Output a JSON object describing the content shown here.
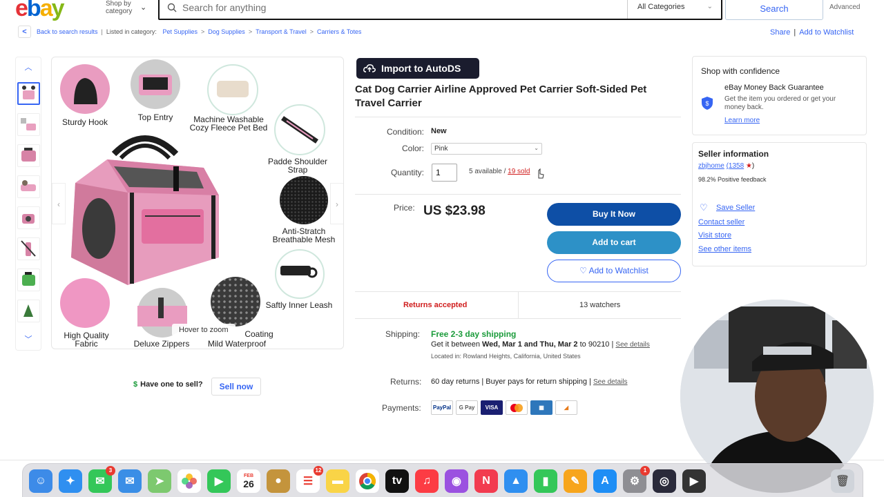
{
  "header": {
    "logo": [
      "e",
      "b",
      "a",
      "y"
    ],
    "shop_by_line1": "Shop by",
    "shop_by_line2": "category",
    "search_placeholder": "Search for anything",
    "category": "All Categories",
    "search_label": "Search",
    "advanced_label": "Advanced"
  },
  "breadcrumb": {
    "back": "Back to search results",
    "listed_in": "Listed in category:",
    "items": [
      "Pet Supplies",
      "Dog Supplies",
      "Transport & Travel",
      "Carriers & Totes"
    ],
    "share": "Share",
    "add_watchlist": "Add to Watchlist"
  },
  "gallery": {
    "features": [
      "Sturdy Hook",
      "Top Entry",
      "Machine Washable Cozy Fleece Pet Bed",
      "Padde Shoulder Strap",
      "Anti-Stratch Breathable Mesh",
      "Saftly Inner Leash",
      "High Quality Fabric",
      "Deluxe Zippers",
      "Mild Waterproof"
    ],
    "coating_fragment": "Coating",
    "hover_zoom": "Hover to zoom"
  },
  "sell": {
    "question": "Have one to sell?",
    "button": "Sell now"
  },
  "listing": {
    "autods_button": "Import to AutoDS",
    "title": "Cat Dog Carrier Airline Approved Pet Carrier Soft-Sided Pet Travel Carrier",
    "condition_label": "Condition:",
    "condition_value": "New",
    "color_label": "Color:",
    "color_value": "Pink",
    "quantity_label": "Quantity:",
    "quantity_value": "1",
    "available": "5 available /",
    "sold": "19 sold",
    "price_label": "Price:",
    "price": "US $23.98",
    "buy_now": "Buy It Now",
    "add_to_cart": "Add to cart",
    "add_to_watchlist": "♡ Add to Watchlist",
    "returns_accepted": "Returns accepted",
    "watchers": "13 watchers",
    "shipping_label": "Shipping:",
    "shipping_free": "Free 2-3 day shipping",
    "get_it_prefix": "Get it between",
    "get_it_dates": "Wed, Mar 1 and Thu, Mar 2",
    "get_it_zip": "to 90210",
    "see_details": "See details",
    "located_in": "Located in: Rowland Heights, California, United States",
    "returns_label": "Returns:",
    "returns_value": "60 day returns | Buyer pays for return shipping |",
    "payments_label": "Payments:",
    "payments": [
      "PayPal",
      "G Pay",
      "VISA",
      "MC",
      "AMEX",
      "DISC"
    ]
  },
  "confidence": {
    "title": "Shop with confidence",
    "guarantee": "eBay Money Back Guarantee",
    "guarantee_desc": "Get the item you ordered or get your money back.",
    "learn_more": "Learn more"
  },
  "seller": {
    "title": "Seller information",
    "name": "zbjhome",
    "score": "(1358",
    "score_end": ")",
    "feedback": "98.2% Positive feedback",
    "save_seller": "Save Seller",
    "contact": "Contact seller",
    "visit_store": "Visit store",
    "other_items": "See other items"
  },
  "dock": {
    "calendar_month": "FEB",
    "calendar_day": "26",
    "badges": {
      "messages": "3",
      "reminders": "12",
      "settings": "1"
    }
  }
}
